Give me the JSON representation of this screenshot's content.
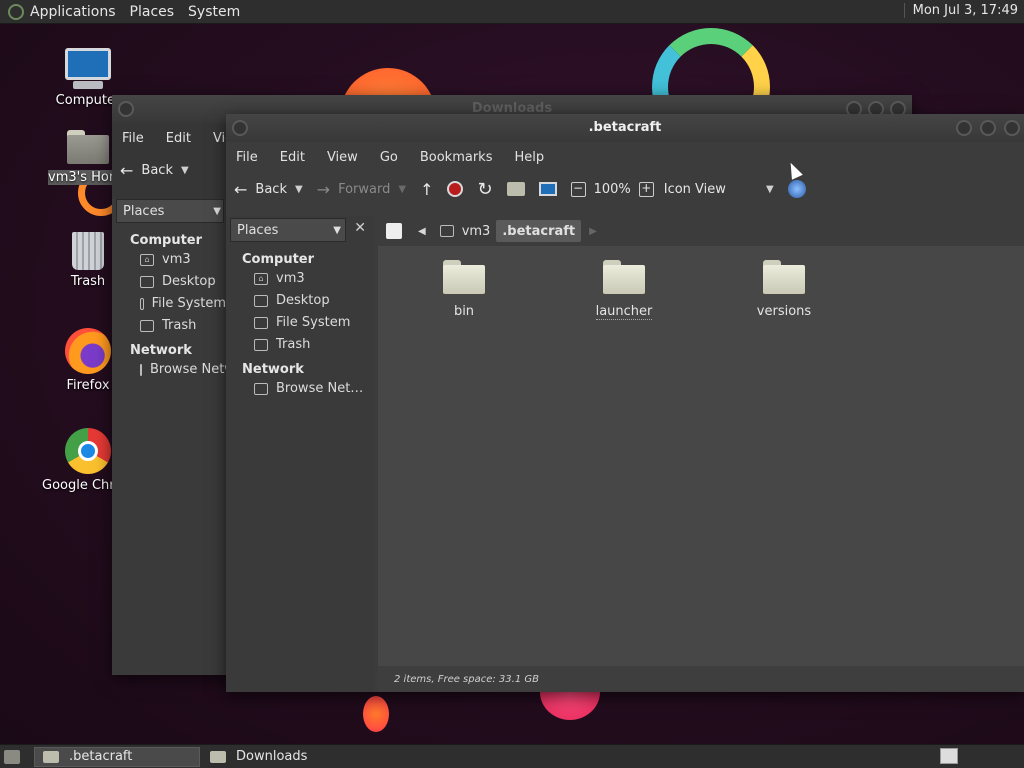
{
  "top_panel": {
    "menus": [
      "Applications",
      "Places",
      "System"
    ],
    "clock": "Mon Jul 3, 17:49"
  },
  "desktop_icons": [
    {
      "label": "Computer",
      "icon": "computer-icon"
    },
    {
      "label": "vm3's Home",
      "icon": "home-folder-icon"
    },
    {
      "label": "Trash",
      "icon": "trash-icon"
    },
    {
      "label": "Firefox",
      "icon": "firefox-icon"
    },
    {
      "label": "Google Chrome",
      "icon": "chrome-icon"
    }
  ],
  "back_window": {
    "title": "Downloads",
    "menus": [
      "File",
      "Edit",
      "View"
    ],
    "back_label": "Back",
    "places_label": "Places",
    "sidebar": {
      "computer_header": "Computer",
      "computer_items": [
        "vm3",
        "Desktop",
        "File System",
        "Trash"
      ],
      "network_header": "Network",
      "network_items": [
        "Browse Network"
      ]
    }
  },
  "front_window": {
    "title": ".betacraft",
    "menus": [
      "File",
      "Edit",
      "View",
      "Go",
      "Bookmarks",
      "Help"
    ],
    "toolbar": {
      "back": "Back",
      "forward": "Forward",
      "zoom": "100%",
      "view_mode": "Icon View"
    },
    "places_label": "Places",
    "sidebar": {
      "computer_header": "Computer",
      "computer_items": [
        "vm3",
        "Desktop",
        "File System",
        "Trash"
      ],
      "network_header": "Network",
      "network_items": [
        "Browse Net…"
      ]
    },
    "path": [
      "vm3",
      ".betacraft"
    ],
    "files": [
      "bin",
      "launcher",
      "versions"
    ],
    "status": "2 items, Free space: 33.1 GB"
  },
  "taskbar": {
    "tasks": [
      ".betacraft",
      "Downloads"
    ]
  },
  "colors": {
    "panel": "#2e2e2e",
    "window": "#3c3c3c",
    "content": "#474747"
  }
}
